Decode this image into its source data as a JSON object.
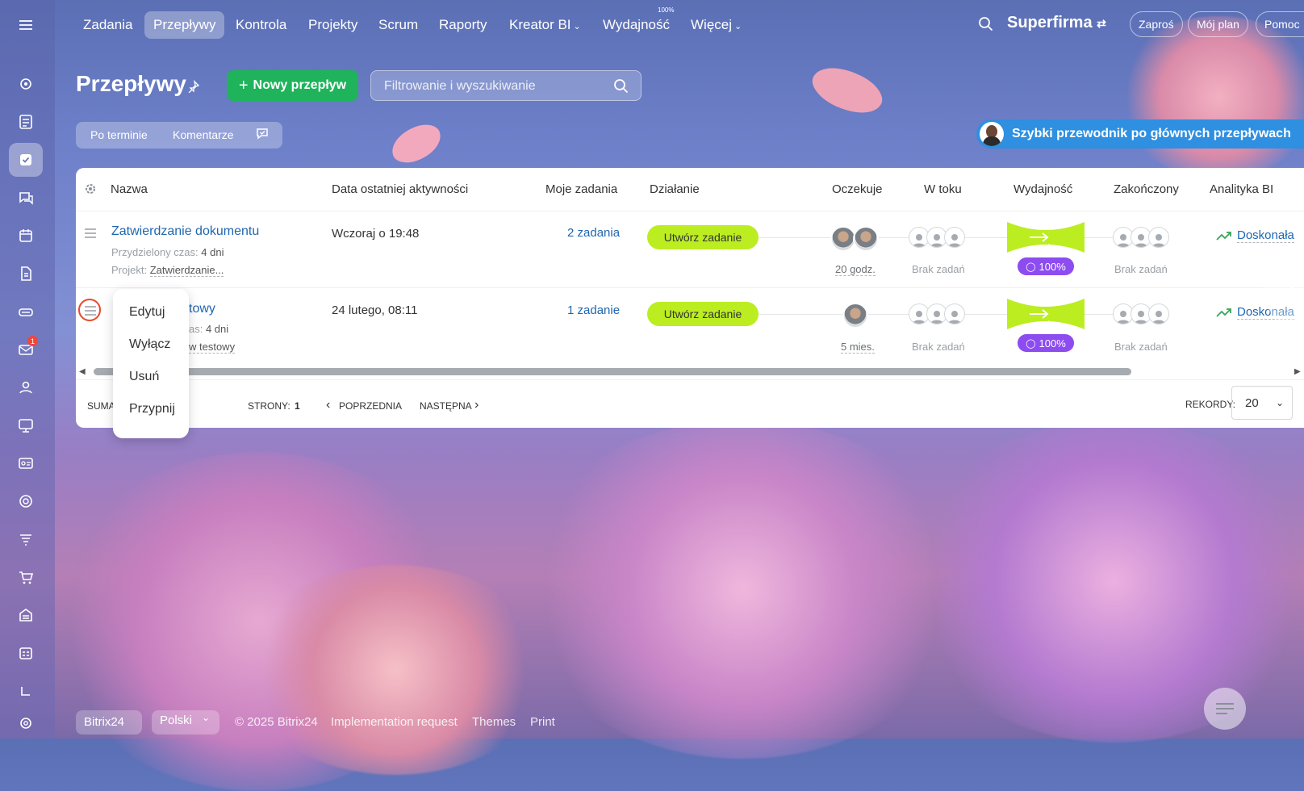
{
  "nav": {
    "items": [
      "Zadania",
      "Przepływy",
      "Kontrola",
      "Projekty",
      "Scrum",
      "Raporty",
      "Kreator BI",
      "Wydajność",
      "Więcej"
    ],
    "active": "Przepływy",
    "efficiency_percent": "100%",
    "company": "Superfirma",
    "invite": "Zaproś",
    "my_plan": "Mój plan",
    "help": "Pomoc"
  },
  "page": {
    "title": "Przepływy",
    "new_button": "Nowy przepływ",
    "search_placeholder": "Filtrowanie i wyszukiwanie",
    "view_by_deadline": "Po terminie",
    "view_comments": "Komentarze",
    "guide": "Szybki przewodnik po głównych przepływach"
  },
  "grid": {
    "columns": [
      "Nazwa",
      "Data ostatniej aktywności",
      "Moje zadania",
      "Działanie",
      "Oczekuje",
      "W toku",
      "Wydajność",
      "Zakończony",
      "Analityka BI"
    ],
    "rows": [
      {
        "name": "Zatwierdzanie dokumentu",
        "time_label": "Przydzielony czas:",
        "time_value": "4 dni",
        "project_label": "Projekt:",
        "project_value": "Zatwierdzanie...",
        "last_activity": "Wczoraj o 19:48",
        "my_tasks": "2 zadania",
        "action": "Utwórz zadanie",
        "waiting_time": "20 godz.",
        "in_progress": "Brak zadań",
        "efficiency": "100%",
        "completed": "Brak zadań",
        "bi": "Doskonała"
      },
      {
        "name": "towy",
        "time_label": "as:",
        "time_value": "4 dni",
        "project_value": "w testowy",
        "last_activity": "24 lutego, 08:11",
        "my_tasks": "1 zadanie",
        "action": "Utwórz zadanie",
        "waiting_time": "5 mies.",
        "in_progress": "Brak zadań",
        "efficiency": "100%",
        "completed": "Brak zadań",
        "bi": "Doskonała"
      }
    ],
    "footer": {
      "summary": "SUMA",
      "pages_label": "STRONY:",
      "page": "1",
      "prev": "POPRZEDNIA",
      "next": "NASTĘPNA",
      "records_label": "REKORDY:",
      "records_value": "20"
    }
  },
  "row_menu": [
    "Edytuj",
    "Wyłącz",
    "Usuń",
    "Przypnij"
  ],
  "sidebar": {
    "mail_badge": "1"
  },
  "bottom": {
    "brand": "Bitrix24",
    "language": "Polski",
    "copyright": "© 2025 Bitrix24",
    "implementation": "Implementation request",
    "themes": "Themes",
    "print": "Print"
  },
  "colors": {
    "accent_green": "#1fb35c",
    "action_lime": "#bbed21",
    "efficiency_purple": "#8d4cf0",
    "link_blue": "#2067b0",
    "guide_blue": "#2f8fe0"
  }
}
